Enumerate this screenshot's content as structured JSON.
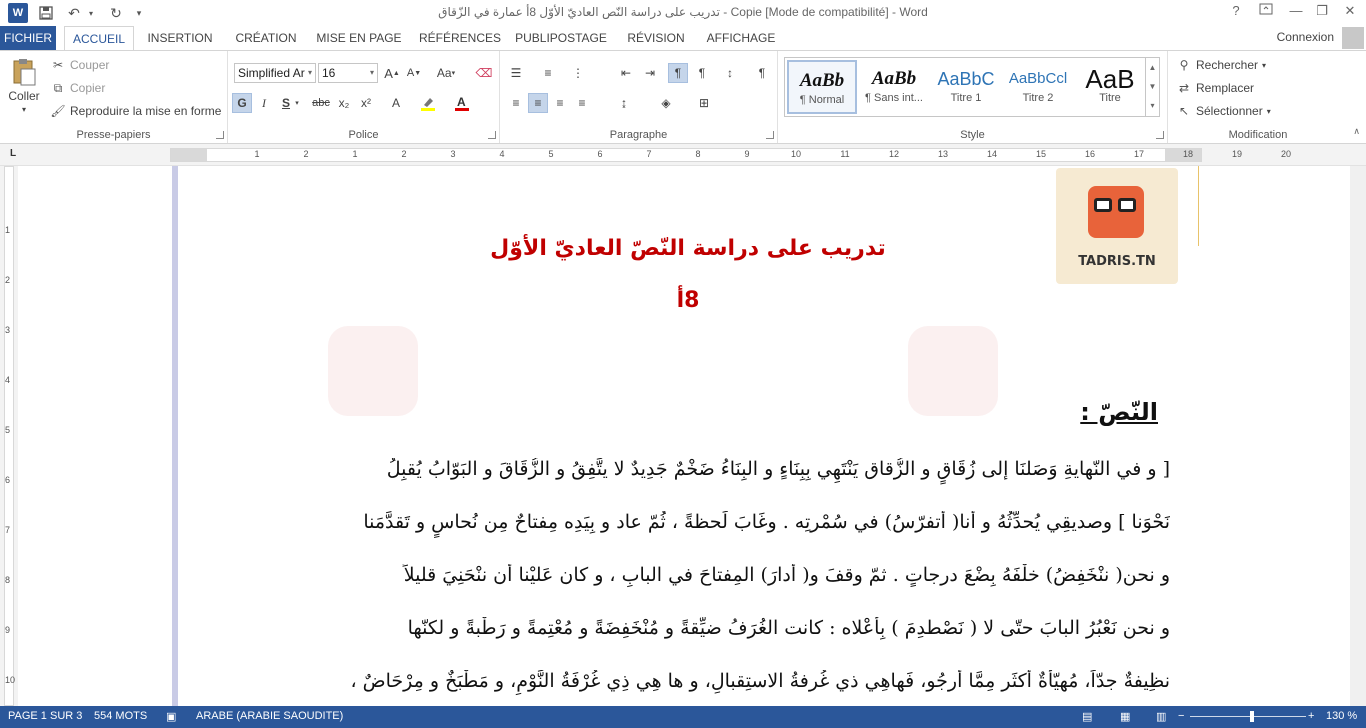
{
  "window": {
    "title": "تدريب على دراسة النّص العاديّ الأوّل 8أ عمارة في الزّقاق - Copie [Mode de compatibilité] - Word",
    "help": "?"
  },
  "quick_access": {
    "app_icon": "W",
    "save": "save-icon",
    "undo": "undo-icon",
    "redo": "redo-icon"
  },
  "tabs": {
    "file": "FICHIER",
    "items": [
      "ACCUEIL",
      "INSERTION",
      "CRÉATION",
      "MISE EN PAGE",
      "RÉFÉRENCES",
      "PUBLIPOSTAGE",
      "RÉVISION",
      "AFFICHAGE"
    ],
    "active": "ACCUEIL",
    "account": "Connexion"
  },
  "clipboard": {
    "label": "Presse-papiers",
    "paste": "Coller",
    "cut": "Couper",
    "copy": "Copier",
    "format_painter": "Reproduire la mise en forme"
  },
  "font": {
    "label": "Police",
    "name": "Simplified Ar",
    "size": "16",
    "bold": "G",
    "italic": "I",
    "underline": "S",
    "strike": "abc",
    "subscript": "x₂",
    "superscript": "x²",
    "grow": "A",
    "shrink": "A",
    "case": "Aa"
  },
  "paragraph": {
    "label": "Paragraphe",
    "marks": "¶"
  },
  "styles": {
    "label": "Style",
    "items": [
      {
        "sample": "AaBb",
        "name": "¶ Normal"
      },
      {
        "sample": "AaBb",
        "name": "¶ Sans int..."
      },
      {
        "sample": "AaBbC",
        "name": "Titre 1"
      },
      {
        "sample": "AaBbCcl",
        "name": "Titre 2"
      },
      {
        "sample": "AaB",
        "name": "Titre"
      }
    ]
  },
  "editing": {
    "label": "Modification",
    "find": "Rechercher",
    "replace": "Remplacer",
    "select": "Sélectionner"
  },
  "ruler": {
    "tab_selector": "L",
    "numbers": [
      "1",
      "2",
      "1",
      "2",
      "3",
      "4",
      "5",
      "6",
      "7",
      "8",
      "9",
      "10",
      "11",
      "12",
      "13",
      "14",
      "15",
      "16",
      "17",
      "18",
      "19",
      "20"
    ],
    "vertical_numbers": [
      "1",
      "2",
      "3",
      "4",
      "5",
      "6",
      "7",
      "8",
      "9",
      "10"
    ]
  },
  "document": {
    "badge_text": "TADRIS.TN",
    "title": "تدريب على دراسة النّصّ العاديّ الأوّل",
    "level": "8أ",
    "section_heading": "النّصّ :",
    "lines": [
      "[ و في النّهايةِ وَصَلنَا إلى زُقَاقٍ و الزُّقاق يَنْتَهِي بِبِنَاءٍ و البِنَاءُ ضَخْمٌ جَدِيدٌ لا يتَّفِقُ و الزُّقَاقَ و البَوّابُ يُقبِلُ",
      "نَحْوَنا ] وصديقِي يُحدِّثُهُ و أنا( أتفرّسُ) في سُمْرتِه . وغَابَ لَحظةً ، ثُمّ عاد و بِيَدِه مِفتاحٌ مِن نُحاسٍ و تَقدَّمَنا",
      "و نحن( ننْخَفِضُ) خلْفَهُ بِضْعَ درجاتٍ . ثمّ وقفَ و( أدارَ) المِفتاحَ في البابِ ، و كان عَليْنا أن ننْحَنِيَ قليلاً",
      "و نحن نَعْبُرُ البابَ حتّى لا ( نَصْطدِمَ ) بِأعْلاه : كانت الغُرَفُ ضيِّقةً و مُنْخَفِضَةً و مُعْتِمةً و رَطْبةً و لكنّها",
      "نظِيفةٌ جدّاً، مُهيّأةٌ أكثَر مِمَّا أَرجُو، فَهاهِي ذي غُرفةُ الاستِقبالِ، و ها هِي ذِي غُرْفَةُ النَّوْمِ، و مَطْبَخٌ و مِرْحَاضٌ ،"
    ]
  },
  "status": {
    "page": "PAGE 1 SUR 3",
    "words": "554 MOTS",
    "language": "ARABE (ARABIE SAOUDITE)",
    "zoom": "130 %",
    "zoom_minus": "−",
    "zoom_plus": "+"
  }
}
